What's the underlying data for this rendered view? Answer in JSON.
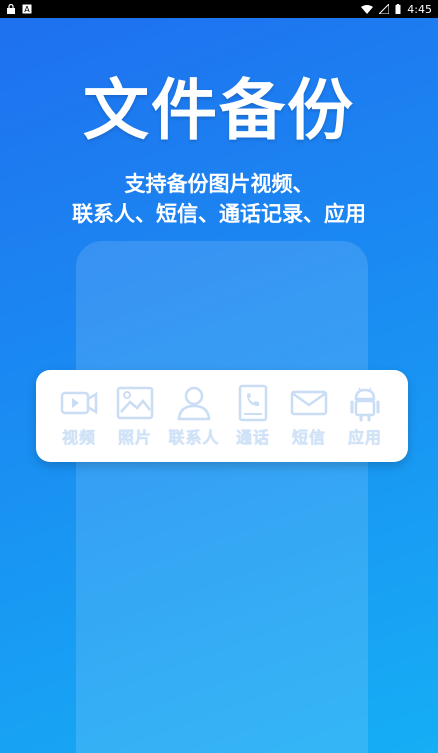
{
  "status_bar": {
    "time": "4:45"
  },
  "hero": {
    "title": "文件备份",
    "subtitle_line1": "支持备份图片视频、",
    "subtitle_line2": "联系人、短信、通话记录、应用"
  },
  "categories": [
    {
      "label": "视频",
      "icon": "video-icon"
    },
    {
      "label": "照片",
      "icon": "photo-icon"
    },
    {
      "label": "联系人",
      "icon": "contact-icon"
    },
    {
      "label": "通话",
      "icon": "call-log-icon"
    },
    {
      "label": "短信",
      "icon": "sms-icon"
    },
    {
      "label": "应用",
      "icon": "android-app-icon"
    }
  ],
  "colors": {
    "background_top": "#1f6fef",
    "background_bottom": "#16aef5",
    "card": "#ffffff",
    "icon_tint": "#cfe2f7"
  }
}
